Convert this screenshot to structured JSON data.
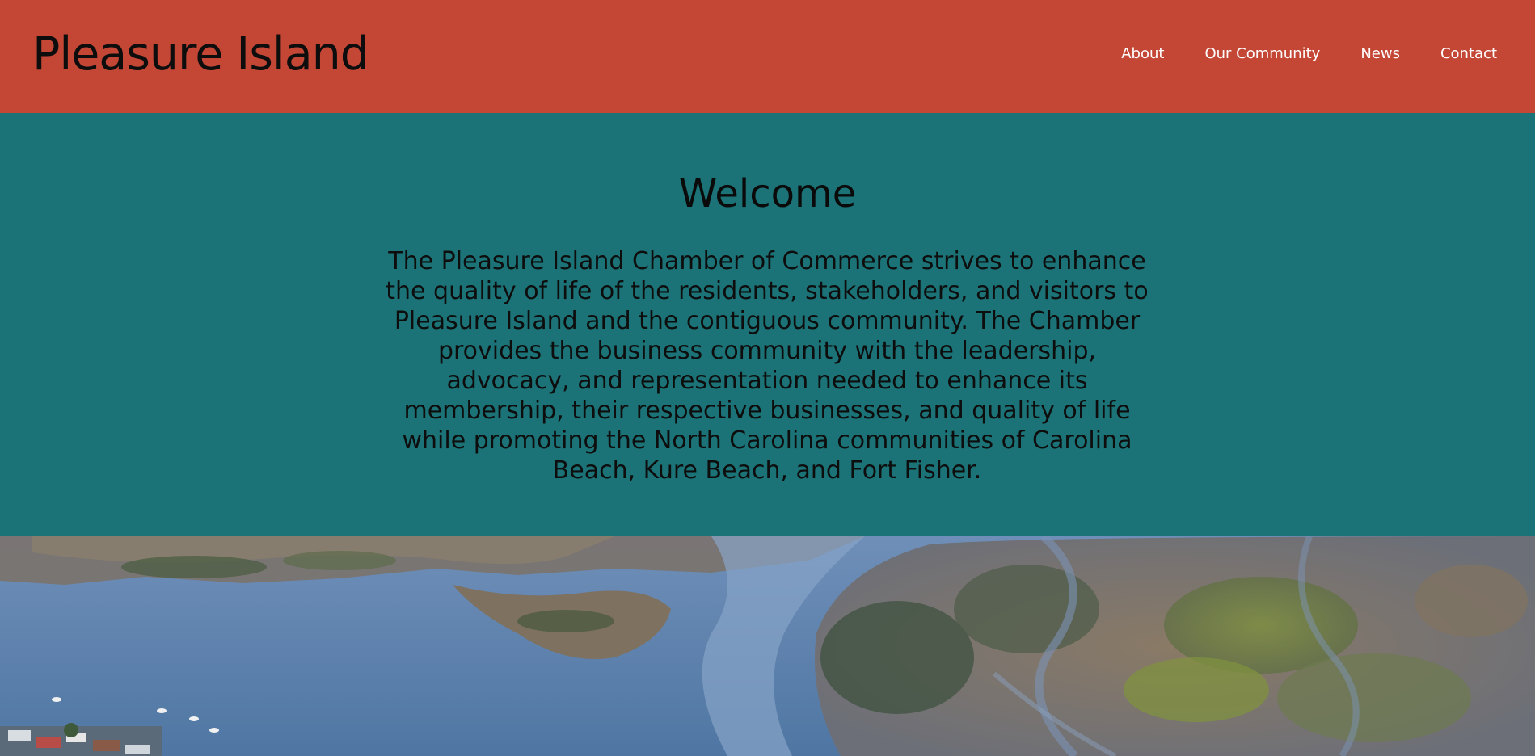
{
  "header": {
    "site_title": "Pleasure Island",
    "background_color": "#c44736",
    "nav": [
      {
        "label": "About"
      },
      {
        "label": "Our Community"
      },
      {
        "label": "News"
      },
      {
        "label": "Contact"
      }
    ]
  },
  "welcome": {
    "heading": "Welcome",
    "body": "The Pleasure Island Chamber of Commerce strives to enhance the quality of life of the residents, stakeholders, and visitors to Pleasure Island and the contiguous community. The Chamber provides the business community with the leadership, advocacy, and representation needed to enhance its membership, their respective businesses, and quality of life while promoting the North Carolina communities of Carolina Beach, Kure Beach, and Fort Fisher.",
    "background_color": "#1c7377"
  },
  "hero_image": {
    "subject": "aerial view of marsh and waterway"
  }
}
